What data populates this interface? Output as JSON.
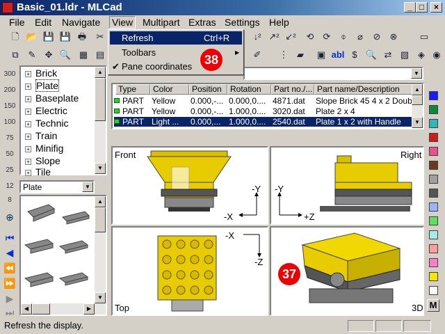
{
  "window": {
    "title": "Basic_01.ldr - MLCad"
  },
  "menu": [
    "File",
    "Edit",
    "Navigate",
    "View",
    "Multipart",
    "Extras",
    "Settings",
    "Help"
  ],
  "view_menu": {
    "items": [
      {
        "label": "Refresh",
        "shortcut": "Ctrl+R",
        "selected": true
      },
      {
        "label": "Toolbars",
        "submenu": true
      },
      {
        "label": "Pane coordinates",
        "checked": true
      }
    ]
  },
  "markers": {
    "menu_marker": "38",
    "view_marker": "37"
  },
  "tree": {
    "items": [
      "Brick",
      "Plate",
      "Baseplate",
      "Electric",
      "Technic",
      "Train",
      "Minifig",
      "Slope",
      "Tile"
    ]
  },
  "left_bar": {
    "labels": [
      "300",
      "200",
      "150",
      "100",
      "75",
      "50",
      "25",
      "12",
      "8"
    ]
  },
  "category_select": {
    "value": "Plate"
  },
  "parts_table": {
    "columns": [
      "Type",
      "Color",
      "Position",
      "Rotation",
      "Part no./...",
      "Part name/Description"
    ],
    "rows": [
      {
        "type": "PART",
        "color": "Yellow",
        "position": "0.000,-...",
        "rotation": "0.000,0....",
        "partno": "4871.dat",
        "name": "Slope Brick 45 4 x 2 Doubl"
      },
      {
        "type": "PART",
        "color": "Yellow",
        "position": "0.000,-...",
        "rotation": "1.000,0....",
        "partno": "3020.dat",
        "name": "Plate 2 x 4"
      },
      {
        "type": "PART",
        "color": "Light ...",
        "position": "0.000,...",
        "rotation": "1.000,0....",
        "partno": "2540.dat",
        "name": "Plate 1 x 2 with Handle"
      }
    ]
  },
  "views": {
    "front": {
      "label": "Front",
      "axis_x": "-X",
      "axis_y": "-Y"
    },
    "right": {
      "label": "Right",
      "axis_x": "+Z",
      "axis_y": "-Y"
    },
    "top": {
      "label": "Top",
      "axis_x": "-X",
      "axis_y": "-Z"
    },
    "threed": {
      "label": "3D"
    }
  },
  "color_palette": [
    "#1a1aff",
    "#0b8a3b",
    "#2fb7b7",
    "#cc1d1d",
    "#e8528c",
    "#6b3a1d",
    "#a0a0a0",
    "#555555",
    "#9bb4ff",
    "#5ee05e",
    "#a8e8e8",
    "#ff9c9c",
    "#ff7fcf",
    "#f7e600",
    "#ffffff"
  ],
  "statusbar": {
    "text": "Refresh the display."
  }
}
